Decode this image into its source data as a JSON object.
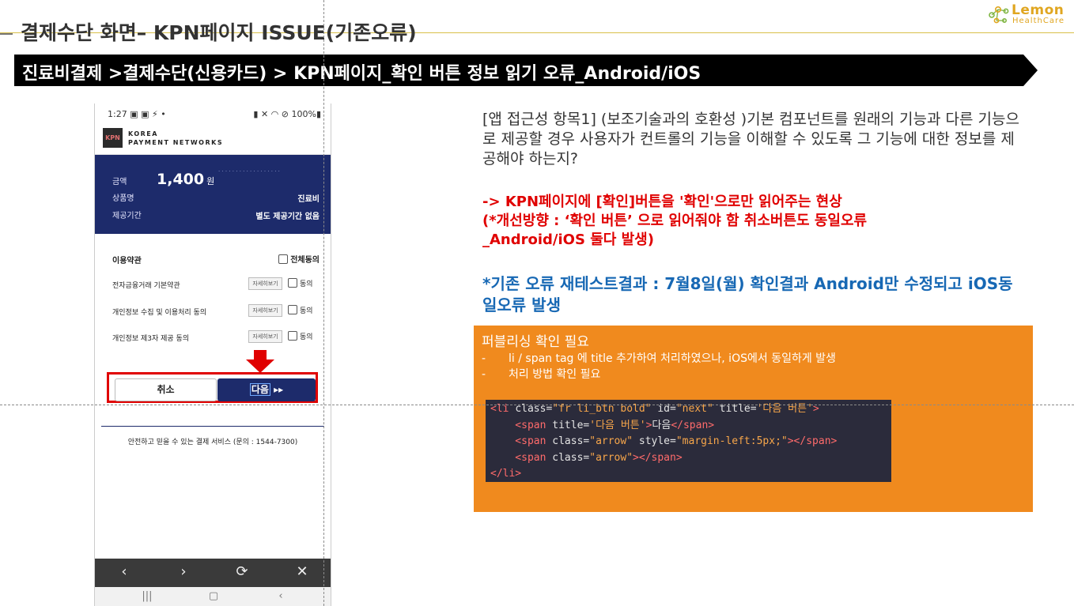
{
  "header": {
    "slide_title": "결제수단 화면– KPN페이지 ISSUE(기존오류)",
    "logo_name": "Lemon",
    "logo_sub": "HealthCare",
    "banner": "진료비결제 >결제수단(신용카드) > KPN페이지_확인 버튼 정보 읽기 오류_Android/iOS"
  },
  "phone": {
    "status_time": "1:27",
    "status_battery": "100%",
    "kpn_logo": "KPN",
    "kpn_name_line1": "KOREA",
    "kpn_name_line2": "PAYMENT NETWORKS",
    "amount_label": "금액",
    "amount_value": "1,400",
    "amount_unit": "원",
    "product_label": "상품명",
    "product_value": "진료비",
    "period_label": "제공기간",
    "period_value": "별도 제공기간 없음",
    "terms_title": "이용약관",
    "all_agree": "전체동의",
    "terms": [
      {
        "label": "전자금융거래 기본약관",
        "detail": "자세히보기",
        "agree": "동의"
      },
      {
        "label": "개인정보 수집 및 이용처리 동의",
        "detail": "자세히보기",
        "agree": "동의"
      },
      {
        "label": "개인정보 제3자 제공 동의",
        "detail": "자세히보기",
        "agree": "동의"
      }
    ],
    "cancel_label": "취소",
    "next_label": "다음",
    "next_arrows": "▸▸",
    "footer": "안전하고 믿을 수 있는 결제 서비스 (문의 : 1544-7300)"
  },
  "notes": {
    "para": "[앱 접근성 항목1] (보조기술과의 호환성 )기본 컴포넌트를 원래의 기능과 다른 기능으로 제공할 경우 사용자가 컨트롤의 기능을 이해할 수 있도록 그 기능에 대한 정보를 제공해야 하는지?",
    "red_line1": "-> KPN페이지에 [확인]버튼을 '확인'으로만 읽어주는 현상",
    "red_line2": "(*개선방향 : ‘확인 버튼’ 으로 읽어줘야 함 취소버튼도 동일오류",
    "red_line3": "_Android/iOS 둘다 발생)",
    "blue_note": "*기존 오류  재테스트결과  : 7월8일(월) 확인결과 Android만 수정되고 iOS동일오류 발생"
  },
  "publishing": {
    "title": "퍼블리싱 확인 필요",
    "bullet1": "li / span tag 에 title 추가하여 처리하였으나, iOS에서 동일하게 발생",
    "bullet2": "처리 방법 확인 필요",
    "code": {
      "l1_open": "<li ",
      "l1_attr1": "class=",
      "l1_val1": "\"fr li_btn bold\"",
      "l1_attr2": " id=",
      "l1_val2": "\"next\"",
      "l1_attr3": " title=",
      "l1_val3": "'다음 버튼'",
      "l1_close": ">",
      "l2_open": "    <span ",
      "l2_attr": "title=",
      "l2_val": "'다음 버튼'",
      "l2_mid": ">",
      "l2_text": "다음",
      "l2_close": "</span>",
      "l3_open": "    <span ",
      "l3_attr1": "class=",
      "l3_val1": "\"arrow\"",
      "l3_attr2": " style=",
      "l3_val2": "\"margin-left:5px;\"",
      "l3_close": "></span>",
      "l4_open": "    <span ",
      "l4_attr": "class=",
      "l4_val": "\"arrow\"",
      "l4_close": "></span>",
      "l5": "</li>"
    }
  },
  "colors": {
    "banner_bg": "#000000",
    "orange": "#f08a1e",
    "red": "#e00000",
    "blue": "#1768b4",
    "kpn_navy": "#1d2b6b"
  }
}
